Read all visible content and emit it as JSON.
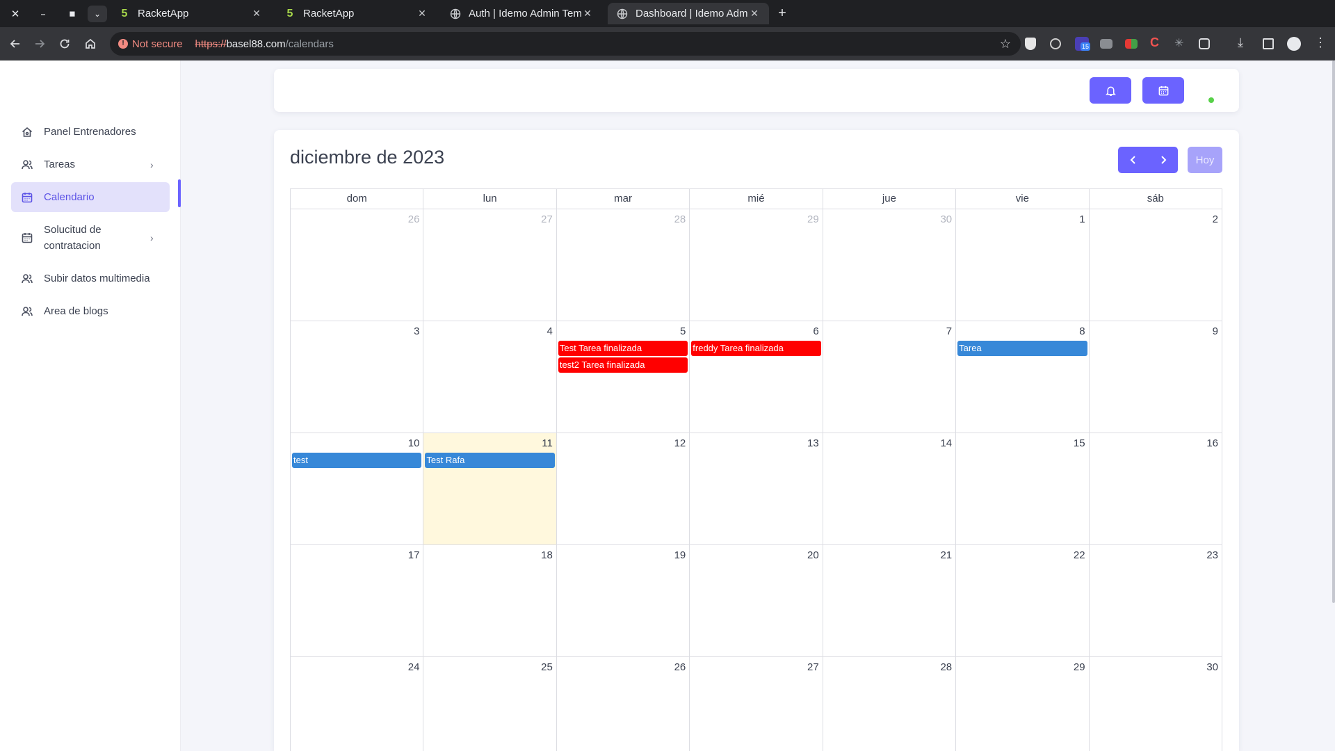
{
  "browser": {
    "tabs": [
      {
        "title": "RacketApp",
        "icon": "five-icon"
      },
      {
        "title": "RacketApp",
        "icon": "five-icon"
      },
      {
        "title": "Auth | Idemo Admin Template",
        "icon": "globe-icon"
      },
      {
        "title": "Dashboard | Idemo Admin Template",
        "icon": "globe-icon"
      }
    ],
    "not_secure": "Not secure",
    "url_scheme": "https://",
    "url_host": "basel88.com",
    "url_path": "/calendars",
    "extension_badge": "15"
  },
  "sidebar": {
    "items": [
      {
        "label": "Panel Entrenadores",
        "icon": "home-icon",
        "chevron": false,
        "active": false
      },
      {
        "label": "Tareas",
        "icon": "users-icon",
        "chevron": true,
        "active": false
      },
      {
        "label": "Calendario",
        "icon": "calendar-icon",
        "chevron": false,
        "active": true
      },
      {
        "label": "Solucitud de contratacion",
        "icon": "calendar-icon",
        "chevron": true,
        "active": false
      },
      {
        "label": "Subir datos multimedia",
        "icon": "users-icon",
        "chevron": false,
        "active": false
      },
      {
        "label": "Area de blogs",
        "icon": "users-icon",
        "chevron": false,
        "active": false
      }
    ]
  },
  "calendar": {
    "title": "diciembre de 2023",
    "today_label": "Hoy",
    "weekdays": [
      "dom",
      "lun",
      "mar",
      "mié",
      "jue",
      "vie",
      "sáb"
    ],
    "weeks": [
      [
        {
          "d": "26",
          "other": true,
          "events": []
        },
        {
          "d": "27",
          "other": true,
          "events": []
        },
        {
          "d": "28",
          "other": true,
          "events": []
        },
        {
          "d": "29",
          "other": true,
          "events": []
        },
        {
          "d": "30",
          "other": true,
          "events": []
        },
        {
          "d": "1",
          "events": []
        },
        {
          "d": "2",
          "events": []
        }
      ],
      [
        {
          "d": "3",
          "events": []
        },
        {
          "d": "4",
          "events": []
        },
        {
          "d": "5",
          "events": [
            {
              "t": "Test Tarea finalizada",
              "c": "red"
            },
            {
              "t": "test2 Tarea finalizada",
              "c": "red"
            }
          ]
        },
        {
          "d": "6",
          "events": [
            {
              "t": "freddy Tarea finalizada",
              "c": "red"
            }
          ]
        },
        {
          "d": "7",
          "events": []
        },
        {
          "d": "8",
          "events": [
            {
              "t": "Tarea",
              "c": "blue"
            }
          ]
        },
        {
          "d": "9",
          "events": []
        }
      ],
      [
        {
          "d": "10",
          "events": [
            {
              "t": "test",
              "c": "blue"
            }
          ]
        },
        {
          "d": "11",
          "today": true,
          "events": [
            {
              "t": "Test Rafa",
              "c": "blue"
            }
          ]
        },
        {
          "d": "12",
          "events": []
        },
        {
          "d": "13",
          "events": []
        },
        {
          "d": "14",
          "events": []
        },
        {
          "d": "15",
          "events": []
        },
        {
          "d": "16",
          "events": []
        }
      ],
      [
        {
          "d": "17",
          "events": []
        },
        {
          "d": "18",
          "events": []
        },
        {
          "d": "19",
          "events": []
        },
        {
          "d": "20",
          "events": []
        },
        {
          "d": "21",
          "events": []
        },
        {
          "d": "22",
          "events": []
        },
        {
          "d": "23",
          "events": []
        }
      ],
      [
        {
          "d": "24",
          "events": []
        },
        {
          "d": "25",
          "events": []
        },
        {
          "d": "26",
          "events": []
        },
        {
          "d": "27",
          "events": []
        },
        {
          "d": "28",
          "events": []
        },
        {
          "d": "29",
          "events": []
        },
        {
          "d": "30",
          "events": []
        }
      ]
    ]
  },
  "colors": {
    "accent": "#6b63ff",
    "event_red": "#ff0000",
    "event_blue": "#3788d8",
    "today_bg": "#fff8dd",
    "status_online": "#57d148"
  }
}
